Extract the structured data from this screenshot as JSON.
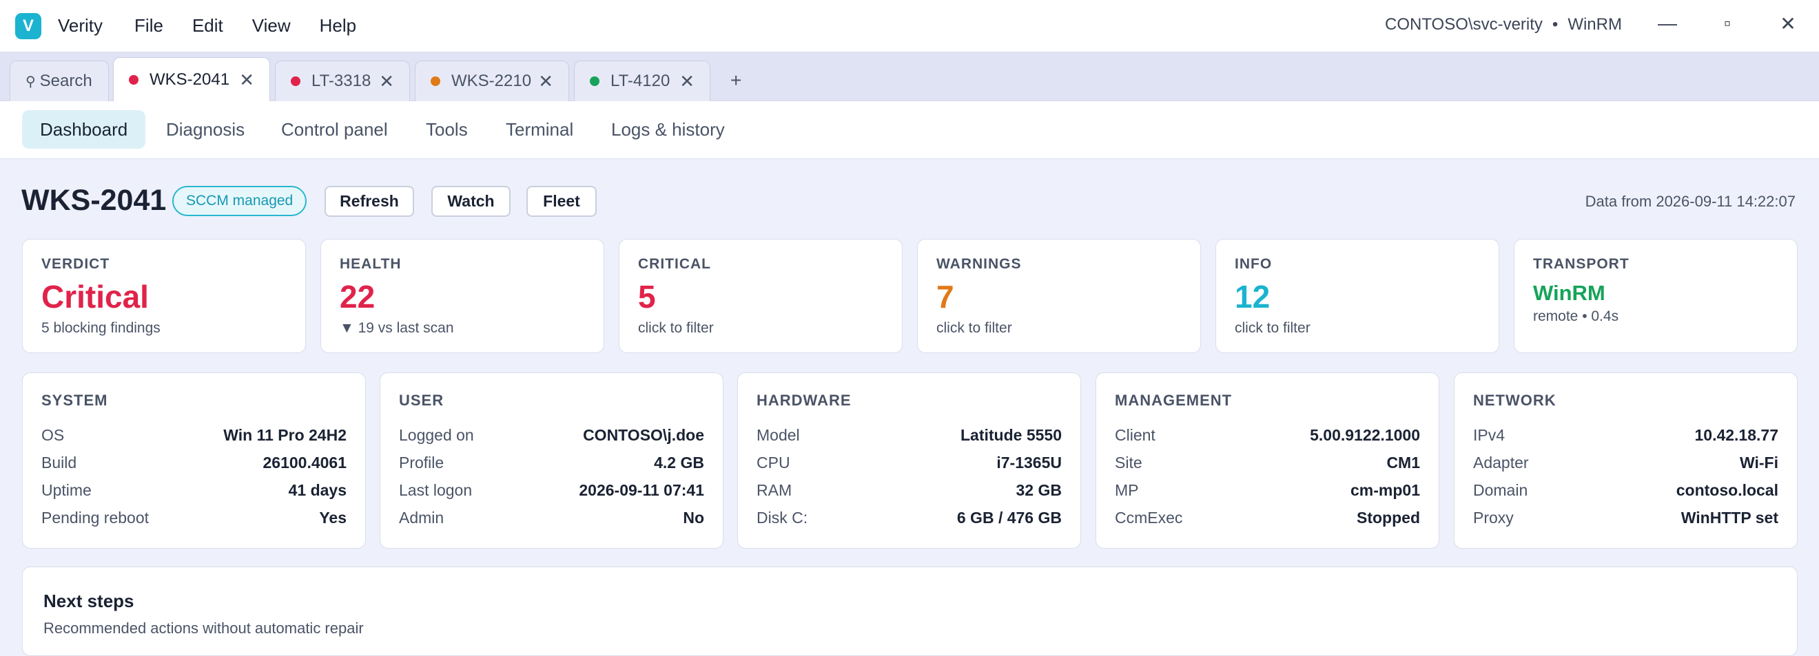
{
  "app": {
    "logo_letter": "V",
    "name": "Verity"
  },
  "menu": [
    "File",
    "Edit",
    "View",
    "Help"
  ],
  "connection": {
    "account": "CONTOSO\\svc-verity",
    "separator": "•",
    "transport": "WinRM"
  },
  "window_controls": {
    "minimize": "—",
    "maximize": "▫",
    "close": "✕"
  },
  "tabs": [
    {
      "label": "Search",
      "icon": "pin-icon"
    },
    {
      "label": "WKS-2041",
      "status_color": "#e0234a",
      "active": true
    },
    {
      "label": "LT-3318",
      "status_color": "#e0234a"
    },
    {
      "label": "WKS-2210",
      "status_color": "#e07a17"
    },
    {
      "label": "LT-4120",
      "status_color": "#17a35a"
    }
  ],
  "tab_close_glyph": "✕",
  "tab_add_glyph": "+",
  "search_glyph": "⚲",
  "subnav": [
    "Dashboard",
    "Diagnosis",
    "Control panel",
    "Tools",
    "Terminal",
    "Logs & history"
  ],
  "header": {
    "host": "WKS-2041",
    "badge": "SCCM managed",
    "buttons": [
      "Refresh",
      "Watch",
      "Fleet"
    ],
    "data_from": "Data from 2026-09-11 14:22:07"
  },
  "stats": [
    {
      "label": "VERDICT",
      "value": "Critical",
      "sub": "5 blocking findings",
      "color": "#e0234a"
    },
    {
      "label": "HEALTH",
      "value": "22",
      "sub": "▼ 19 vs last scan",
      "color": "#e0234a"
    },
    {
      "label": "CRITICAL",
      "value": "5",
      "sub": "click to filter",
      "color": "#e0234a"
    },
    {
      "label": "WARNINGS",
      "value": "7",
      "sub": "click to filter",
      "color": "#e07a17"
    },
    {
      "label": "INFO",
      "value": "12",
      "sub": "click to filter",
      "color": "#1bb3cf"
    },
    {
      "label": "TRANSPORT",
      "value": "WinRM",
      "sub": "remote • 0.4s",
      "color": "#17a35a"
    }
  ],
  "info_cards": [
    {
      "title": "SYSTEM",
      "rows": [
        [
          "OS",
          "Win 11 Pro 24H2"
        ],
        [
          "Build",
          "26100.4061"
        ],
        [
          "Uptime",
          "41 days"
        ],
        [
          "Pending reboot",
          "Yes"
        ]
      ]
    },
    {
      "title": "USER",
      "rows": [
        [
          "Logged on",
          "CONTOSO\\j.doe"
        ],
        [
          "Profile",
          "4.2 GB"
        ],
        [
          "Last logon",
          "2026-09-11 07:41"
        ],
        [
          "Admin",
          "No"
        ]
      ]
    },
    {
      "title": "HARDWARE",
      "rows": [
        [
          "Model",
          "Latitude 5550"
        ],
        [
          "CPU",
          "i7-1365U"
        ],
        [
          "RAM",
          "32 GB"
        ],
        [
          "Disk C:",
          "6 GB / 476 GB"
        ]
      ]
    },
    {
      "title": "MANAGEMENT",
      "rows": [
        [
          "Client",
          "5.00.9122.1000"
        ],
        [
          "Site",
          "CM1"
        ],
        [
          "MP",
          "cm-mp01"
        ],
        [
          "CcmExec",
          "Stopped"
        ]
      ]
    },
    {
      "title": "NETWORK",
      "rows": [
        [
          "IPv4",
          "10.42.18.77"
        ],
        [
          "Adapter",
          "Wi-Fi"
        ],
        [
          "Domain",
          "contoso.local"
        ],
        [
          "Proxy",
          "WinHTTP set"
        ]
      ]
    }
  ],
  "next_steps": {
    "title": "Next steps",
    "subtitle": "Recommended actions without automatic repair"
  }
}
